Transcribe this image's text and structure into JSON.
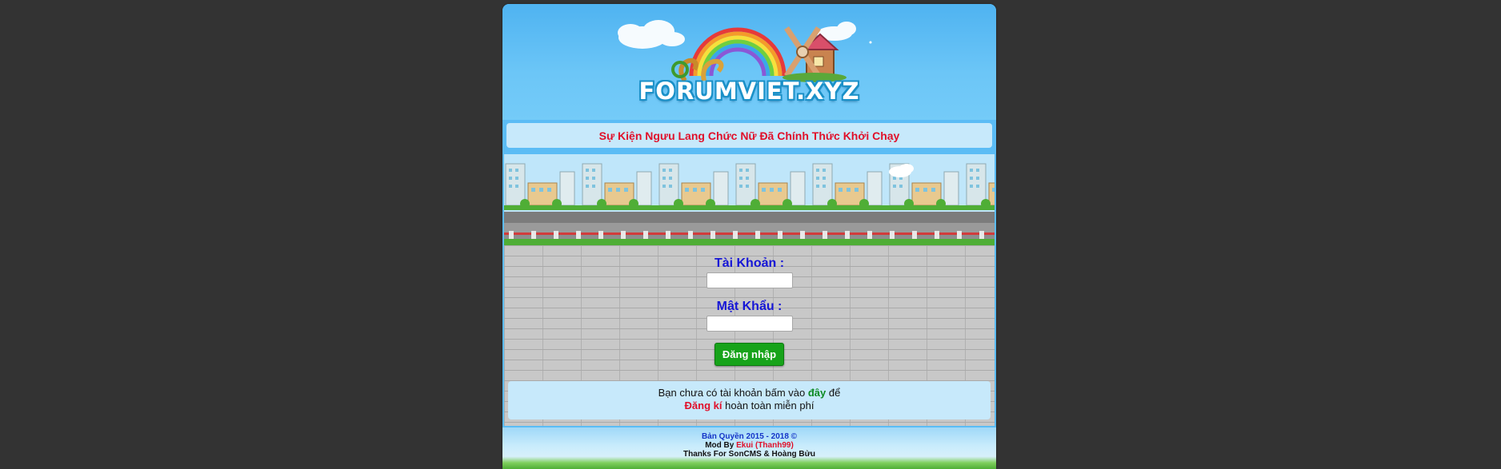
{
  "site": {
    "logo_text": "FORUMVIET.XYZ",
    "notice": "Sự Kiện Ngưu Lang Chức Nữ Đã Chính Thức Khởi Chạy"
  },
  "login": {
    "username_label": "Tài Khoản :",
    "username_value": "",
    "password_label": "Mật Khẩu :",
    "password_value": "",
    "submit_label": "Đăng nhập"
  },
  "signup": {
    "line1_prefix": "Bạn chưa có tài khoản bấm vào ",
    "link_here": "đây",
    "line1_suffix": " để",
    "link_register": "Đăng kí",
    "line2_suffix": " hoàn toàn miễn phí"
  },
  "footer": {
    "copyright": "Bản Quyền 2015 - 2018 ©",
    "mod_prefix": "Mod By ",
    "mod_name": "Ekui (Thanh99)",
    "thanks": "Thanks For SonCMS & Hoàng Bửu"
  },
  "colors": {
    "page_bg": "#333333",
    "header_sky": "#5bbcf5",
    "notice_text": "#e0102a",
    "label_blue": "#1616d6",
    "button_green": "#17a31a"
  }
}
